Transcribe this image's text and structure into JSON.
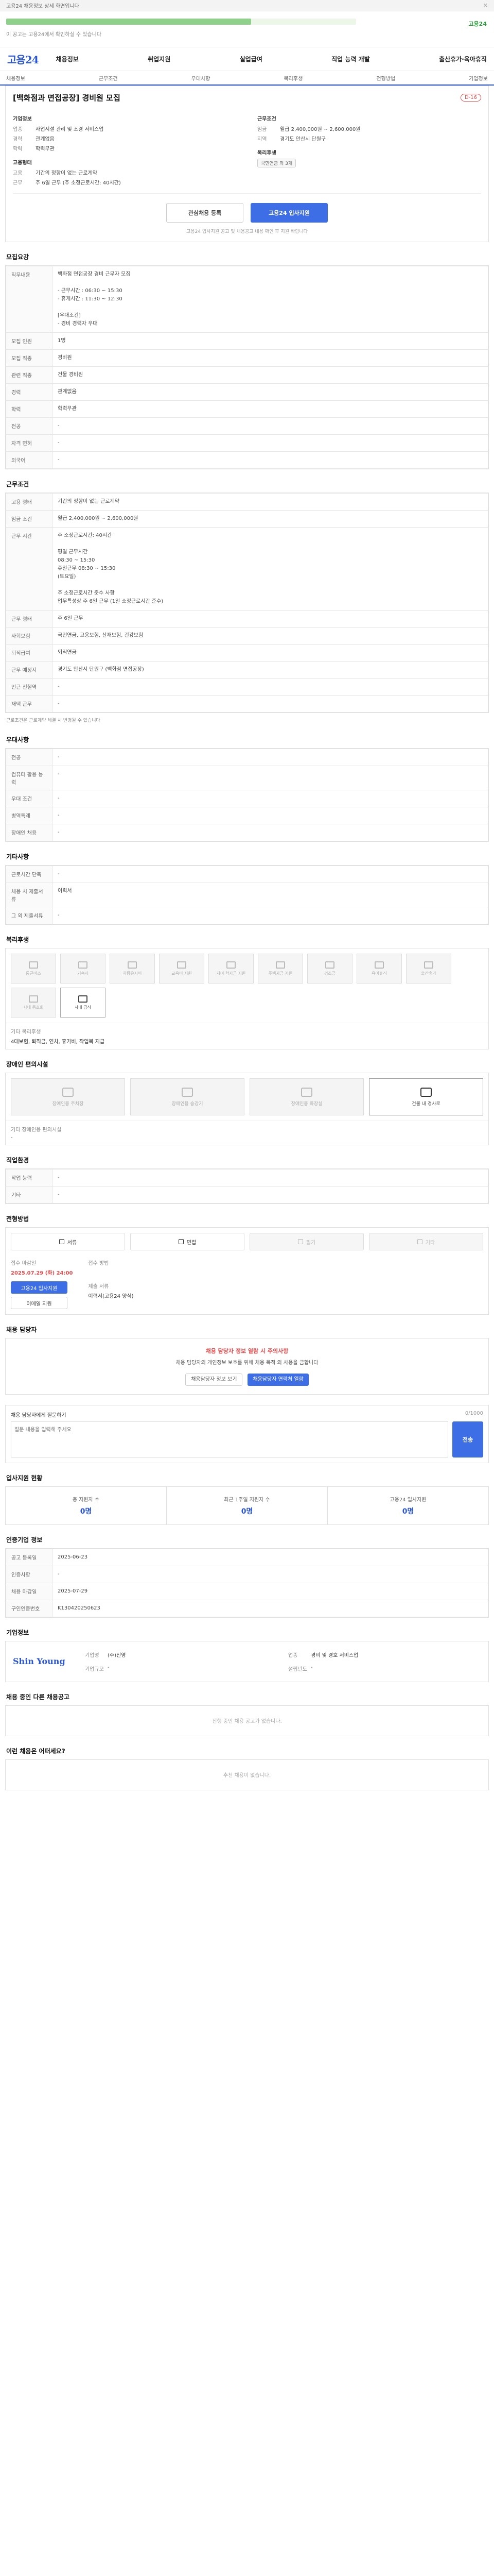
{
  "topbar": {
    "text": "고용24 채용정보 상세 화면입니다",
    "close": "✕"
  },
  "banner": {
    "progress": 0.7,
    "green_text": "고용24",
    "sub": "이 공고는 고용24에서 확인하실 수 있습니다"
  },
  "logo": "고용24",
  "gnb": [
    "채용정보",
    "취업지원",
    "실업급여",
    "직업 능력 개발",
    "출산휴가·육아휴직"
  ],
  "subnav": [
    "채용정보",
    "근무조건",
    "우대사항",
    "복리후생",
    "전형방법",
    "기업정보"
  ],
  "job": {
    "title": "[백화점과 면접공장] 경비원 모집",
    "dday": "D-16",
    "company_label": "기업정보",
    "rows": [
      {
        "k": "업종",
        "v": "사업시설 관리 및 조경 서비스업"
      },
      {
        "k": "경력",
        "v": "관계없음"
      },
      {
        "k": "학력",
        "v": "학력무관"
      }
    ],
    "cond_label": "근무조건",
    "cond_rows": [
      {
        "k": "임금",
        "v": "월급 2,400,000원 ~ 2,600,000원"
      },
      {
        "k": "지역",
        "v": "경기도 안산시 단원구"
      }
    ],
    "employ_label": "고용형태",
    "employ_rows": [
      {
        "k": "고용",
        "v": "기간의 정함이 없는 근로계약"
      },
      {
        "k": "근무",
        "v": "주 6일 근무 (주 소정근로시간: 40시간)"
      }
    ],
    "welfare_label": "복리후생",
    "welfare_chip": "국민연금 외 3개"
  },
  "apply": {
    "scrap": "관심채용 등록",
    "apply": "고용24 입사지원",
    "note": "고용24 입사지원 공고 및 채용공고 내용 확인 후 지원 바랍니다"
  },
  "sec1": {
    "title": "모집요강",
    "rows": [
      {
        "k": "직무내용",
        "v": "백화점 면접공장 경비 근무자 모집\n\n- 근무시간 : 06:30 ~ 15:30\n- 휴게시간 : 11:30 ~ 12:30\n\n[우대조건]\n- 경비 경력자 우대"
      },
      {
        "k": "모집 인원",
        "v": "1명"
      },
      {
        "k": "모집 직종",
        "v": "경비원"
      },
      {
        "k": "관련 직종",
        "v": "건물 경비원"
      },
      {
        "k": "경력",
        "v": "관계없음"
      },
      {
        "k": "학력",
        "v": "학력무관"
      },
      {
        "k": "전공",
        "v": "-"
      },
      {
        "k": "자격 면허",
        "v": "-"
      },
      {
        "k": "외국어",
        "v": "-"
      }
    ]
  },
  "sec2": {
    "title": "근무조건",
    "rows": [
      {
        "k": "고용 형태",
        "v": "기간의 정함이 없는 근로계약"
      },
      {
        "k": "임금 조건",
        "v": "월급 2,400,000원 ~ 2,600,000원"
      },
      {
        "k": "근무 시간",
        "v": "주 소정근로시간: 40시간\n\n평일 근무시간\n08:30 ~ 15:30\n휴일근무 08:30 ~ 15:30\n(토요일)\n\n주 소정근로시간 준수 사항\n업무특성상 주 6일 근무 (1일 소정근로시간 준수)"
      },
      {
        "k": "근무 형태",
        "v": "주 6일 근무"
      },
      {
        "k": "사회보험",
        "v": "국민연금, 고용보험, 산재보험, 건강보험"
      },
      {
        "k": "퇴직급여",
        "v": "퇴직연금"
      },
      {
        "k": "근무 예정지",
        "v": "경기도 안산시 단원구 (백화점 면접공장)"
      },
      {
        "k": "인근 전철역",
        "v": "-"
      },
      {
        "k": "재택 근무",
        "v": "-"
      }
    ],
    "note": "근로조건은 근로계약 체결 시 변경될 수 있습니다"
  },
  "sec3": {
    "title": "우대사항",
    "rows": [
      {
        "k": "전공",
        "v": "-"
      },
      {
        "k": "컴퓨터 활용 능력",
        "v": "-"
      },
      {
        "k": "우대 조건",
        "v": "-"
      },
      {
        "k": "병역특례",
        "v": "-"
      },
      {
        "k": "장애인 채용",
        "v": "-"
      }
    ]
  },
  "sec4": {
    "title": "기타사항",
    "rows": [
      {
        "k": "근로시간 단축",
        "v": "-"
      },
      {
        "k": "채용 시 제출서류",
        "v": "이력서"
      },
      {
        "k": "그 외 제출서류",
        "v": "-"
      }
    ]
  },
  "sec5": {
    "title": "복리후생",
    "icons": [
      "통근버스",
      "기숙사",
      "차량유지비",
      "교육비 지원",
      "자녀 학자금 지원",
      "주택자금 지원",
      "경조금",
      "육아휴직",
      "출산휴가",
      "사내 동호회",
      "사내 급식"
    ],
    "active": [
      10
    ],
    "other_label": "기타 복리후생",
    "other": "4대보험, 퇴직금, 연차, 휴가비, 작업복 지급"
  },
  "sec6": {
    "title": "장애인 편의시설",
    "cards": [
      "장애인용 주차장",
      "장애인용 승강기",
      "장애인용 화장실",
      "건물 내 경사로"
    ],
    "active": [
      3
    ],
    "other_label": "기타 장애인용 편의시설",
    "other": "-"
  },
  "sec7": {
    "title": "직업환경",
    "rows": [
      {
        "k": "작업 능력",
        "v": "-"
      },
      {
        "k": "기타",
        "v": "-"
      }
    ]
  },
  "sec8": {
    "title": "전형방법",
    "methods": [
      "서류",
      "면접",
      "필기",
      "기타"
    ],
    "off": [
      2,
      3
    ],
    "deadline_label": "접수 마감일",
    "deadline": "2025.07.29 (화) 24:00",
    "apply_label": "접수 방법",
    "apply_btn": "고용24 입사지원",
    "other_btn": "이메일 지원",
    "docs_label": "제출 서류",
    "docs": "이력서(고용24 양식)"
  },
  "sec9": {
    "title": "채용 담당자",
    "warn": "채용 담당자 정보 열람 시 주의사항",
    "body": "채용 담당자의 개인정보 보호를 위해 채용 목적 외 사용을 금합니다",
    "btn1": "채용담당자 정보 보기",
    "btn2": "채용담당자 연락처 열람"
  },
  "qna": {
    "label": "채용 담당자에게 질문하기",
    "placeholder": "질문 내용을 입력해 주세요",
    "btn": "전송",
    "count": "0/1000"
  },
  "stats": {
    "title": "입사지원 현황",
    "items": [
      {
        "lab": "총 지원자 수",
        "val": "0명"
      },
      {
        "lab": "최근 1주일 지원자 수",
        "val": "0명"
      },
      {
        "lab": "고용24 입사지원",
        "val": "0명"
      }
    ]
  },
  "info": {
    "title": "인증기업 정보",
    "rows": [
      {
        "k": "공고 등록일",
        "v": "2025-06-23"
      },
      {
        "k": "인증사항",
        "v": "-"
      },
      {
        "k": "채용 마감일",
        "v": "2025-07-29"
      },
      {
        "k": "구인인증번호",
        "v": "K130420250623"
      }
    ]
  },
  "company": {
    "title": "기업정보",
    "name": "Shin Young",
    "rows": [
      {
        "k": "기업명",
        "v": "(주)신영"
      },
      {
        "k": "업종",
        "v": "경비 및 경호 서비스업"
      },
      {
        "k": "기업규모",
        "v": "-"
      },
      {
        "k": "설립년도",
        "v": "-"
      }
    ]
  },
  "related": {
    "title": "채용 중인 다른 채용공고",
    "empty": "진행 중인 채용 공고가 없습니다."
  },
  "recommend": {
    "title": "이런 채용은 어떠세요?",
    "empty": "추천 채용이 없습니다."
  }
}
